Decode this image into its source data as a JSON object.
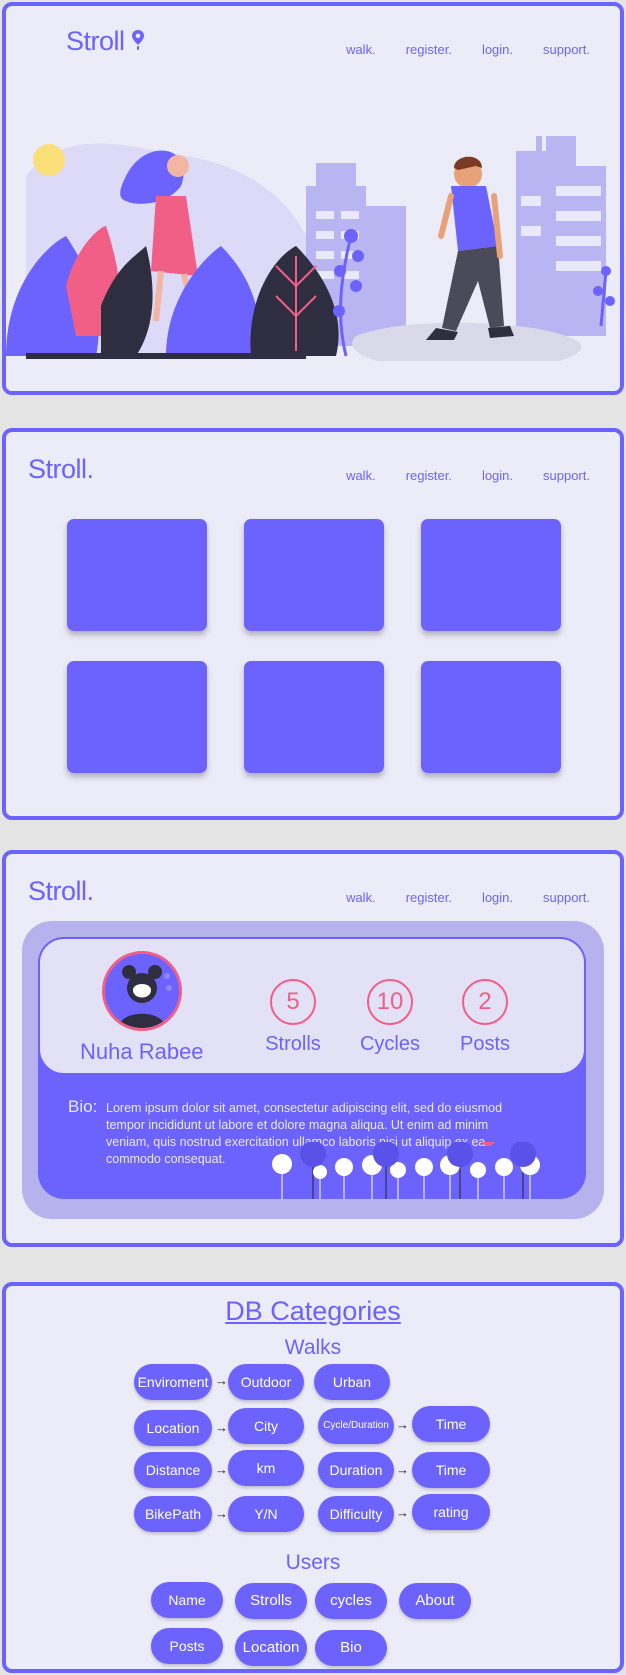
{
  "brand": {
    "logo_pin": "Stroll",
    "logo_dot": "Stroll."
  },
  "nav": {
    "walk": "walk.",
    "register": "register.",
    "login": "login.",
    "support": "support."
  },
  "colors": {
    "accent": "#6c63ff",
    "panel_bg": "#ecebf8",
    "highlight": "#f25f86"
  },
  "profile": {
    "name": "Nuha Rabee",
    "stats": [
      {
        "value": "5",
        "label": "Strolls"
      },
      {
        "value": "10",
        "label": "Cycles"
      },
      {
        "value": "2",
        "label": "Posts"
      }
    ],
    "bio_label": "Bio:",
    "bio_text": "Lorem ipsum dolor sit amet, consectetur adipiscing elit, sed do eiusmod tempor incididunt ut labore et dolore magna aliqua. Ut enim ad minim veniam, quis nostrud exercitation ullamco laboris nisi ut aliquip ex ea commodo consequat."
  },
  "db": {
    "title": "DB Categories",
    "walks_title": "Walks",
    "walks": {
      "enviroment": "Enviroment",
      "outdoor": "Outdoor",
      "urban": "Urban",
      "location": "Location",
      "city": "City",
      "cycle_duration": "Cycle/Duration",
      "time1": "Time",
      "distance": "Distance",
      "km": "km",
      "duration": "Duration",
      "time2": "Time",
      "bikepath": "BikePath",
      "yn": "Y/N",
      "difficulty": "Difficulty",
      "rating": "rating"
    },
    "arrow": "→",
    "users_title": "Users",
    "users": {
      "name": "Name",
      "strolls": "Strolls",
      "cycles": "cycles",
      "about": "About",
      "posts": "Posts",
      "location": "Location",
      "bio": "Bio"
    }
  }
}
